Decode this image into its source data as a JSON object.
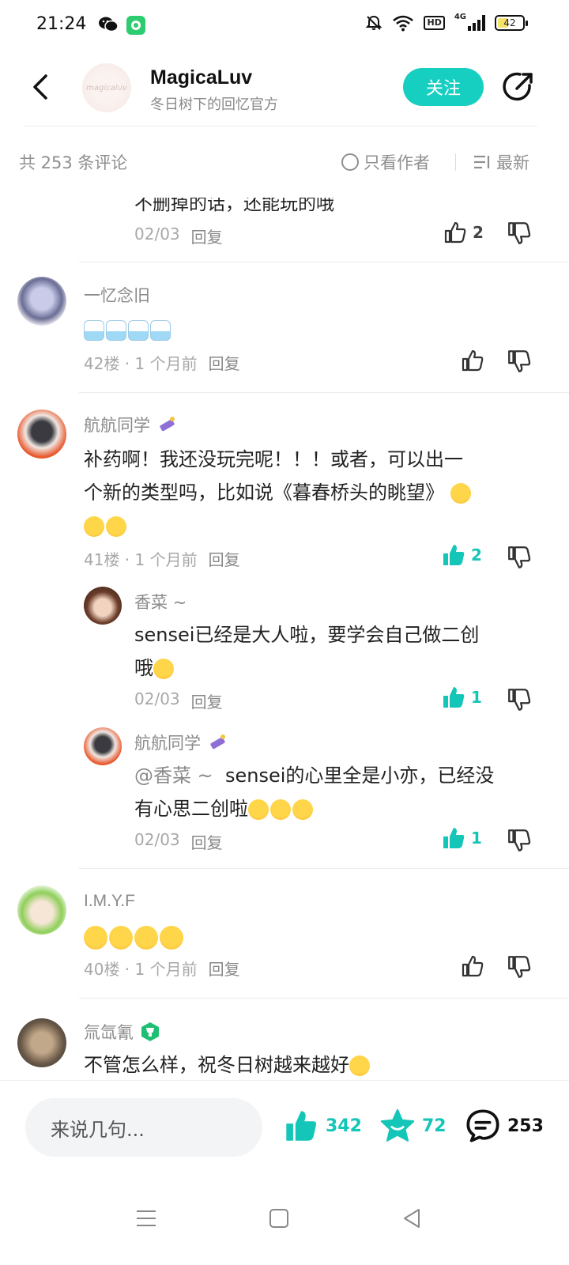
{
  "status_bar": {
    "time": "21:24",
    "hd": "HD",
    "network": "4G",
    "battery": "42",
    "battery_level": 0.42
  },
  "header": {
    "author_name": "MagicaLuv",
    "author_subtitle": "冬日树下的回忆官方",
    "logo_text": "magicaluv",
    "follow_label": "关注"
  },
  "filter": {
    "count_label": "共 253 条评论",
    "only_author_label": "只看作者",
    "sort_label": "最新"
  },
  "partial": {
    "text": "不删掉的话，还能玩的哦",
    "date": "02/03",
    "reply": "回复",
    "likes": "2"
  },
  "comments": [
    {
      "user": "一忆念旧",
      "floor": "42楼 · 1 个月前",
      "reply": "回复",
      "likes": ""
    },
    {
      "user": "航航同学",
      "text_line1": "补药啊！我还没玩完呢！！！或者，可以出一",
      "text_line2": "个新的类型吗，比如说《暮春桥头的眺望》",
      "floor": "41楼 · 1 个月前",
      "reply": "回复",
      "likes": "2"
    },
    {
      "user": "I.M.Y.F",
      "floor": "40楼 · 1 个月前",
      "reply": "回复",
      "likes": ""
    },
    {
      "user": "氚氙氰",
      "text": "不管怎么样，祝冬日树越来越好"
    }
  ],
  "replies": [
    {
      "user": "香菜 ~",
      "text_line1": "sensei已经是大人啦，要学会自己做二创",
      "text_line2": "哦",
      "date": "02/03",
      "reply": "回复",
      "likes": "1"
    },
    {
      "user": "航航同学",
      "mention": "@香菜 ~",
      "text_line1": "sensei的心里全是小亦，已经没",
      "text_line2": "有心思二创啦",
      "date": "02/03",
      "reply": "回复",
      "likes": "1"
    }
  ],
  "bottom_bar": {
    "input_placeholder": "来说几句...",
    "likes": "342",
    "stars": "72",
    "comments": "253"
  },
  "colors": {
    "accent": "#14c6b8",
    "follow_bg": "#17cfc1"
  }
}
